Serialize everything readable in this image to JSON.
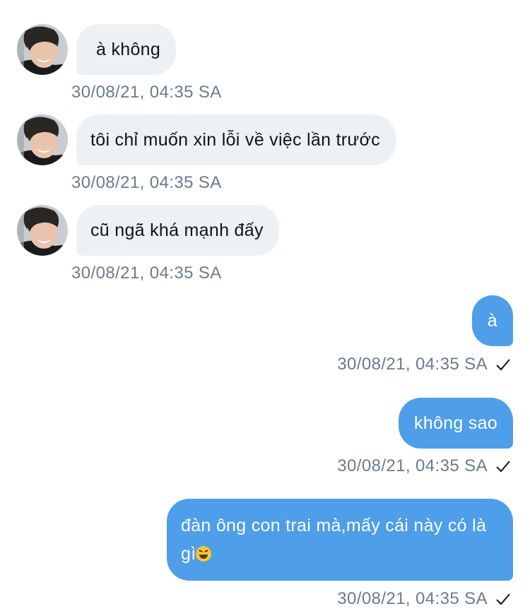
{
  "messages": [
    {
      "direction": "incoming",
      "text": "à không",
      "time": "30/08/21, 04:35 SA"
    },
    {
      "direction": "incoming",
      "text": "tôi chỉ muốn xin lỗi về việc lần trước",
      "time": "30/08/21, 04:35 SA"
    },
    {
      "direction": "incoming",
      "text": "cũ ngã khá mạnh đấy",
      "time": "30/08/21, 04:35 SA"
    },
    {
      "direction": "outgoing",
      "text": "à",
      "time": "30/08/21, 04:35 SA",
      "status_icon": "check-icon"
    },
    {
      "direction": "outgoing",
      "text": "không sao",
      "time": "30/08/21, 04:35 SA",
      "status_icon": "check-icon"
    },
    {
      "direction": "outgoing",
      "text": "đàn ông con trai mà,mấy cái này có là gì",
      "emoji": "grinning-squinting-face-icon",
      "time": "30/08/21, 04:35 SA",
      "status_icon": "check-icon"
    }
  ],
  "colors": {
    "incoming_bubble": "#eef1f4",
    "outgoing_bubble": "#4e9ee9",
    "timestamp": "#6b7c8c",
    "text_dark": "#0f1419"
  }
}
